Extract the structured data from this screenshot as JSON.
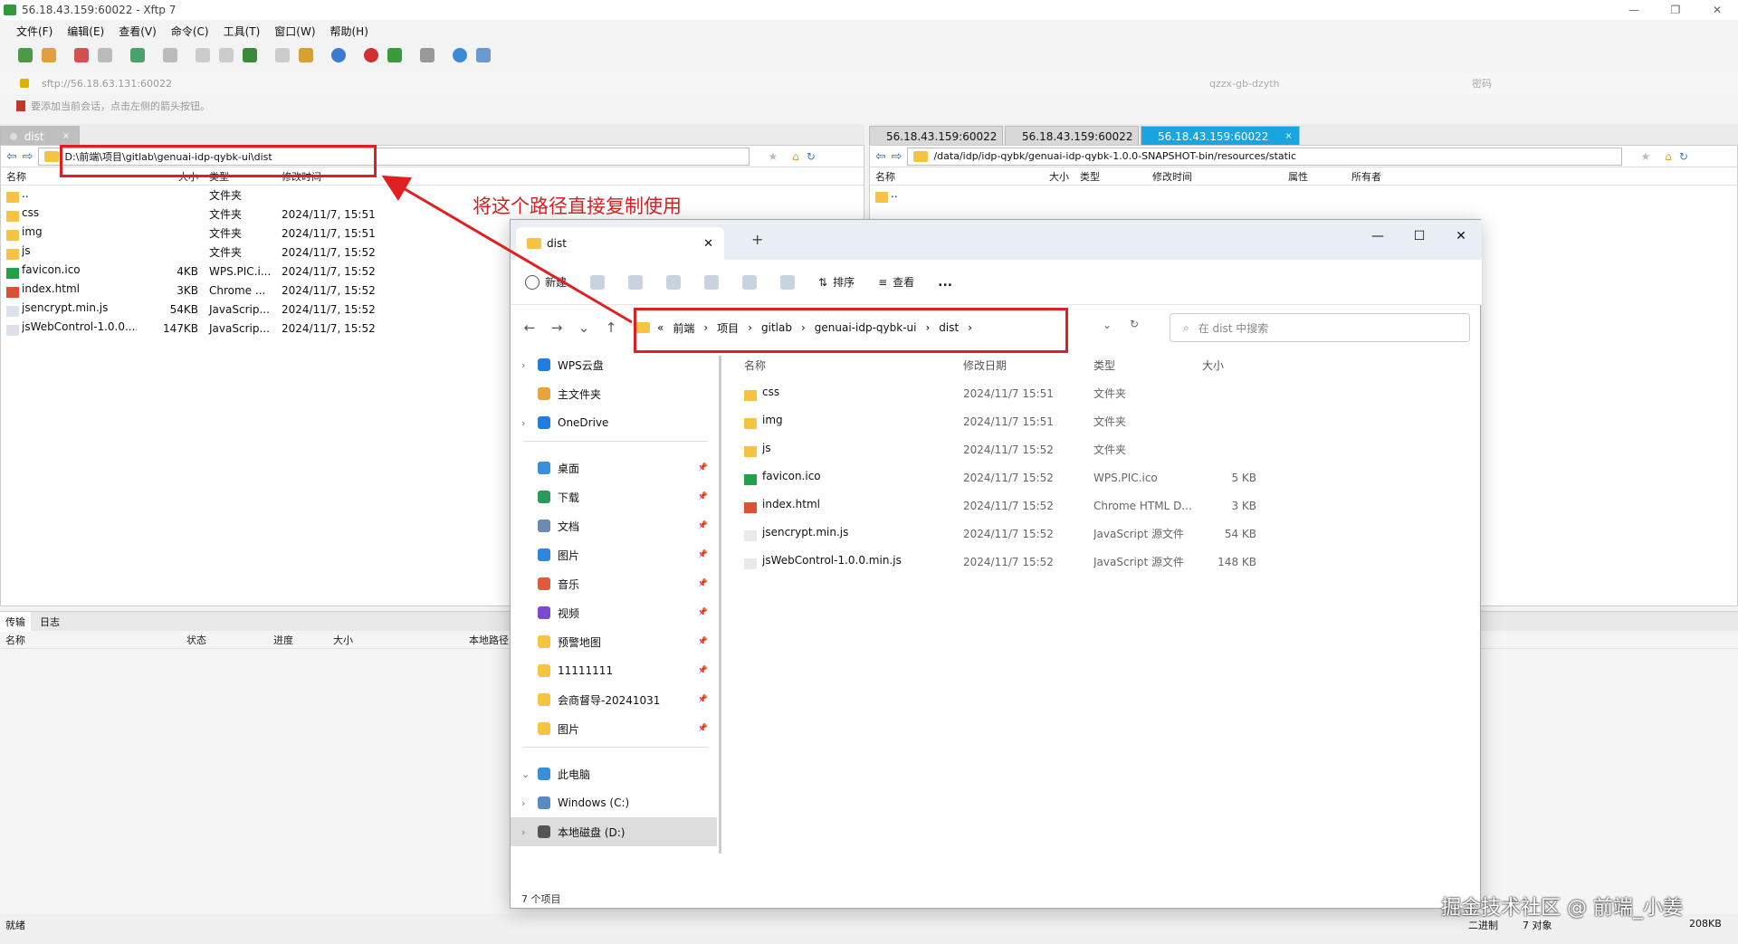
{
  "xftp": {
    "title": "56.18.43.159:60022 - Xftp 7",
    "menu": [
      "文件(F)",
      "编辑(E)",
      "查看(V)",
      "命令(C)",
      "工具(T)",
      "窗口(W)",
      "帮助(H)"
    ],
    "address": "sftp://56.18.63.131:60022",
    "user": "qzzx-gb-dzyth",
    "password_label": "密码",
    "hint": "要添加当前会话，点击左侧的箭头按钮。",
    "left": {
      "tab": "dist",
      "path": "D:\\前端\\项目\\gitlab\\genuai-idp-qybk-ui\\dist",
      "columns": [
        "名称",
        "大小",
        "类型",
        "修改时间"
      ],
      "rows": [
        {
          "name": "..",
          "size": "",
          "type": "文件夹",
          "time": ""
        },
        {
          "name": "css",
          "size": "",
          "type": "文件夹",
          "time": "2024/11/7, 15:51"
        },
        {
          "name": "img",
          "size": "",
          "type": "文件夹",
          "time": "2024/11/7, 15:51"
        },
        {
          "name": "js",
          "size": "",
          "type": "文件夹",
          "time": "2024/11/7, 15:52"
        },
        {
          "name": "favicon.ico",
          "size": "4KB",
          "type": "WPS.PIC.i...",
          "time": "2024/11/7, 15:52"
        },
        {
          "name": "index.html",
          "size": "3KB",
          "type": "Chrome ...",
          "time": "2024/11/7, 15:52"
        },
        {
          "name": "jsencrypt.min.js",
          "size": "54KB",
          "type": "JavaScrip...",
          "time": "2024/11/7, 15:52"
        },
        {
          "name": "jsWebControl-1.0.0....",
          "size": "147KB",
          "type": "JavaScrip...",
          "time": "2024/11/7, 15:52"
        }
      ]
    },
    "right": {
      "tabs": [
        "56.18.43.159:60022",
        "56.18.43.159:60022",
        "56.18.43.159:60022"
      ],
      "path": "/data/idp/idp-qybk/genuai-idp-qybk-1.0.0-SNAPSHOT-bin/resources/static",
      "columns": [
        "名称",
        "大小",
        "类型",
        "修改时间",
        "属性",
        "所有者"
      ],
      "rows": [
        {
          "name": ".."
        }
      ]
    },
    "transfer": {
      "tabs": [
        "传输",
        "日志"
      ],
      "columns": [
        "名称",
        "状态",
        "进度",
        "大小",
        "本地路径"
      ]
    },
    "status": {
      "left": "就绪",
      "mode": "二进制",
      "count": "7 对象",
      "size": "208KB"
    }
  },
  "annotation": "将这个路径直接复制使用",
  "explorer": {
    "tab": "dist",
    "commands": [
      "新建",
      "排序",
      "查看",
      "..."
    ],
    "breadcrumb": [
      "«",
      "前端",
      "项目",
      "gitlab",
      "genuai-idp-qybk-ui",
      "dist"
    ],
    "search_placeholder": "在 dist 中搜索",
    "sidebar": [
      {
        "label": "WPS云盘",
        "color": "#1f7fe0",
        "pin": false
      },
      {
        "label": "主文件夹",
        "color": "#e8a33d",
        "pin": false
      },
      {
        "label": "OneDrive",
        "color": "#1f7fe0",
        "pin": false
      },
      {
        "label": "桌面",
        "color": "#3a8fd8",
        "pin": true
      },
      {
        "label": "下载",
        "color": "#2a9a5a",
        "pin": true
      },
      {
        "label": "文档",
        "color": "#6b8bb0",
        "pin": true
      },
      {
        "label": "图片",
        "color": "#2e86de",
        "pin": true
      },
      {
        "label": "音乐",
        "color": "#e05a3a",
        "pin": true
      },
      {
        "label": "视频",
        "color": "#7a4bd0",
        "pin": true
      },
      {
        "label": "预警地图",
        "color": "#f6c343",
        "pin": true
      },
      {
        "label": "11111111",
        "color": "#f6c343",
        "pin": true
      },
      {
        "label": "会商督导-20241031",
        "color": "#f6c343",
        "pin": true
      },
      {
        "label": "图片",
        "color": "#f6c343",
        "pin": true
      },
      {
        "label": "此电脑",
        "color": "#3a8fd8",
        "pin": false
      },
      {
        "label": "Windows (C:)",
        "color": "#5a8ac0",
        "pin": false
      },
      {
        "label": "本地磁盘 (D:)",
        "color": "#555555",
        "pin": false
      }
    ],
    "columns": [
      "名称",
      "修改日期",
      "类型",
      "大小"
    ],
    "rows": [
      {
        "name": "css",
        "date": "2024/11/7 15:51",
        "type": "文件夹",
        "size": ""
      },
      {
        "name": "img",
        "date": "2024/11/7 15:51",
        "type": "文件夹",
        "size": ""
      },
      {
        "name": "js",
        "date": "2024/11/7 15:52",
        "type": "文件夹",
        "size": ""
      },
      {
        "name": "favicon.ico",
        "date": "2024/11/7 15:52",
        "type": "WPS.PIC.ico",
        "size": "5 KB"
      },
      {
        "name": "index.html",
        "date": "2024/11/7 15:52",
        "type": "Chrome HTML D...",
        "size": "3 KB"
      },
      {
        "name": "jsencrypt.min.js",
        "date": "2024/11/7 15:52",
        "type": "JavaScript 源文件",
        "size": "54 KB"
      },
      {
        "name": "jsWebControl-1.0.0.min.js",
        "date": "2024/11/7 15:52",
        "type": "JavaScript 源文件",
        "size": "148 KB"
      }
    ],
    "status": "7 个项目"
  },
  "watermark": "掘金技术社区 @ 前端_小姜"
}
